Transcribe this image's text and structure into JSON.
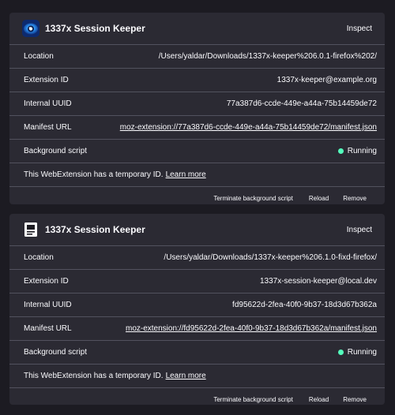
{
  "extensions": [
    {
      "name": "1337x Session Keeper",
      "icon": "eye-logo-icon",
      "inspect_label": "Inspect",
      "rows": [
        {
          "label": "Location",
          "value": "/Users/yaldar/Downloads/1337x-keeper%206.0.1-firefox%202/"
        },
        {
          "label": "Extension ID",
          "value": "1337x-keeper@example.org"
        },
        {
          "label": "Internal UUID",
          "value": "77a387d6-ccde-449e-a44a-75b14459de72"
        },
        {
          "label": "Manifest URL",
          "value": "moz-extension://77a387d6-ccde-449e-a44a-75b14459de72/manifest.json"
        },
        {
          "label": "Background script",
          "value": "Running"
        }
      ],
      "temp_text": "This WebExtension has a temporary ID.",
      "learn_more": "Learn more",
      "actions": {
        "terminate": "Terminate background script",
        "reload": "Reload",
        "remove": "Remove"
      }
    },
    {
      "name": "1337x Session Keeper",
      "icon": "generic-extension-icon",
      "inspect_label": "Inspect",
      "rows": [
        {
          "label": "Location",
          "value": "/Users/yaldar/Downloads/1337x-keeper%206.1.0-fixd-firefox/"
        },
        {
          "label": "Extension ID",
          "value": "1337x-session-keeper@local.dev"
        },
        {
          "label": "Internal UUID",
          "value": "fd95622d-2fea-40f0-9b37-18d3d67b362a"
        },
        {
          "label": "Manifest URL",
          "value": "moz-extension://fd95622d-2fea-40f0-9b37-18d3d67b362a/manifest.json"
        },
        {
          "label": "Background script",
          "value": "Running"
        }
      ],
      "temp_text": "This WebExtension has a temporary ID.",
      "learn_more": "Learn more",
      "actions": {
        "terminate": "Terminate background script",
        "reload": "Reload",
        "remove": "Remove"
      }
    }
  ],
  "colors": {
    "background": "#1c1b22",
    "card": "#2b2a33",
    "divider": "#52525e",
    "running_dot": "#54ffbd"
  }
}
